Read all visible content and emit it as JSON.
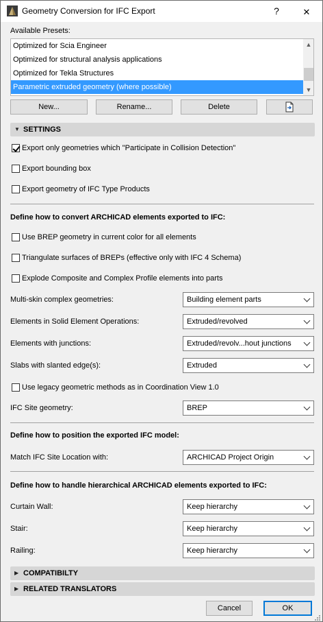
{
  "window": {
    "title": "Geometry Conversion for IFC Export",
    "help_label": "?"
  },
  "presets": {
    "label": "Available Presets:",
    "items": [
      "Optimized for Scia Engineer",
      "Optimized for structural analysis applications",
      "Optimized for Tekla Structures",
      "Parametric extruded geometry (where possible)"
    ],
    "selected_index": 3,
    "buttons": {
      "new": "New...",
      "rename": "Rename...",
      "delete": "Delete"
    }
  },
  "settings": {
    "header": "SETTINGS",
    "options": [
      {
        "label": "Export only geometries which \"Participate in Collision Detection\"",
        "checked": true
      },
      {
        "label": "Export bounding box",
        "checked": false
      },
      {
        "label": "Export geometry of IFC Type Products",
        "checked": false
      }
    ]
  },
  "convert": {
    "heading": "Define how to convert ARCHICAD elements exported to IFC:",
    "options": [
      {
        "label": "Use BREP geometry in current color for all elements",
        "checked": false
      },
      {
        "label": "Triangulate surfaces of BREPs (effective only with IFC 4 Schema)",
        "checked": false
      },
      {
        "label": "Explode Composite and Complex Profile elements into parts",
        "checked": false
      }
    ],
    "combos": [
      {
        "label": "Multi-skin complex geometries:",
        "value": "Building element parts"
      },
      {
        "label": "Elements in Solid Element Operations:",
        "value": "Extruded/revolved"
      },
      {
        "label": "Elements with junctions:",
        "value": "Extruded/revolv...hout junctions"
      },
      {
        "label": "Slabs with slanted edge(s):",
        "value": "Extruded"
      }
    ],
    "legacy": {
      "label": "Use legacy geometric methods as in Coordination View 1.0",
      "checked": false
    },
    "site": {
      "label": "IFC Site geometry:",
      "value": "BREP"
    }
  },
  "position": {
    "heading": "Define how to position the exported IFC model:",
    "match": {
      "label": "Match IFC Site Location with:",
      "value": "ARCHICAD Project Origin"
    }
  },
  "hierarchy": {
    "heading": "Define how to handle hierarchical ARCHICAD elements exported to IFC:",
    "combos": [
      {
        "label": "Curtain Wall:",
        "value": "Keep hierarchy"
      },
      {
        "label": "Stair:",
        "value": "Keep hierarchy"
      },
      {
        "label": "Railing:",
        "value": "Keep hierarchy"
      }
    ]
  },
  "collapsed": {
    "compat": "COMPATIBILTY",
    "related": "RELATED TRANSLATORS"
  },
  "footer": {
    "cancel": "Cancel",
    "ok": "OK"
  },
  "colors": {
    "selection": "#3399ff",
    "section_header": "#d6d6d6",
    "default_button_border": "#0078d7"
  }
}
